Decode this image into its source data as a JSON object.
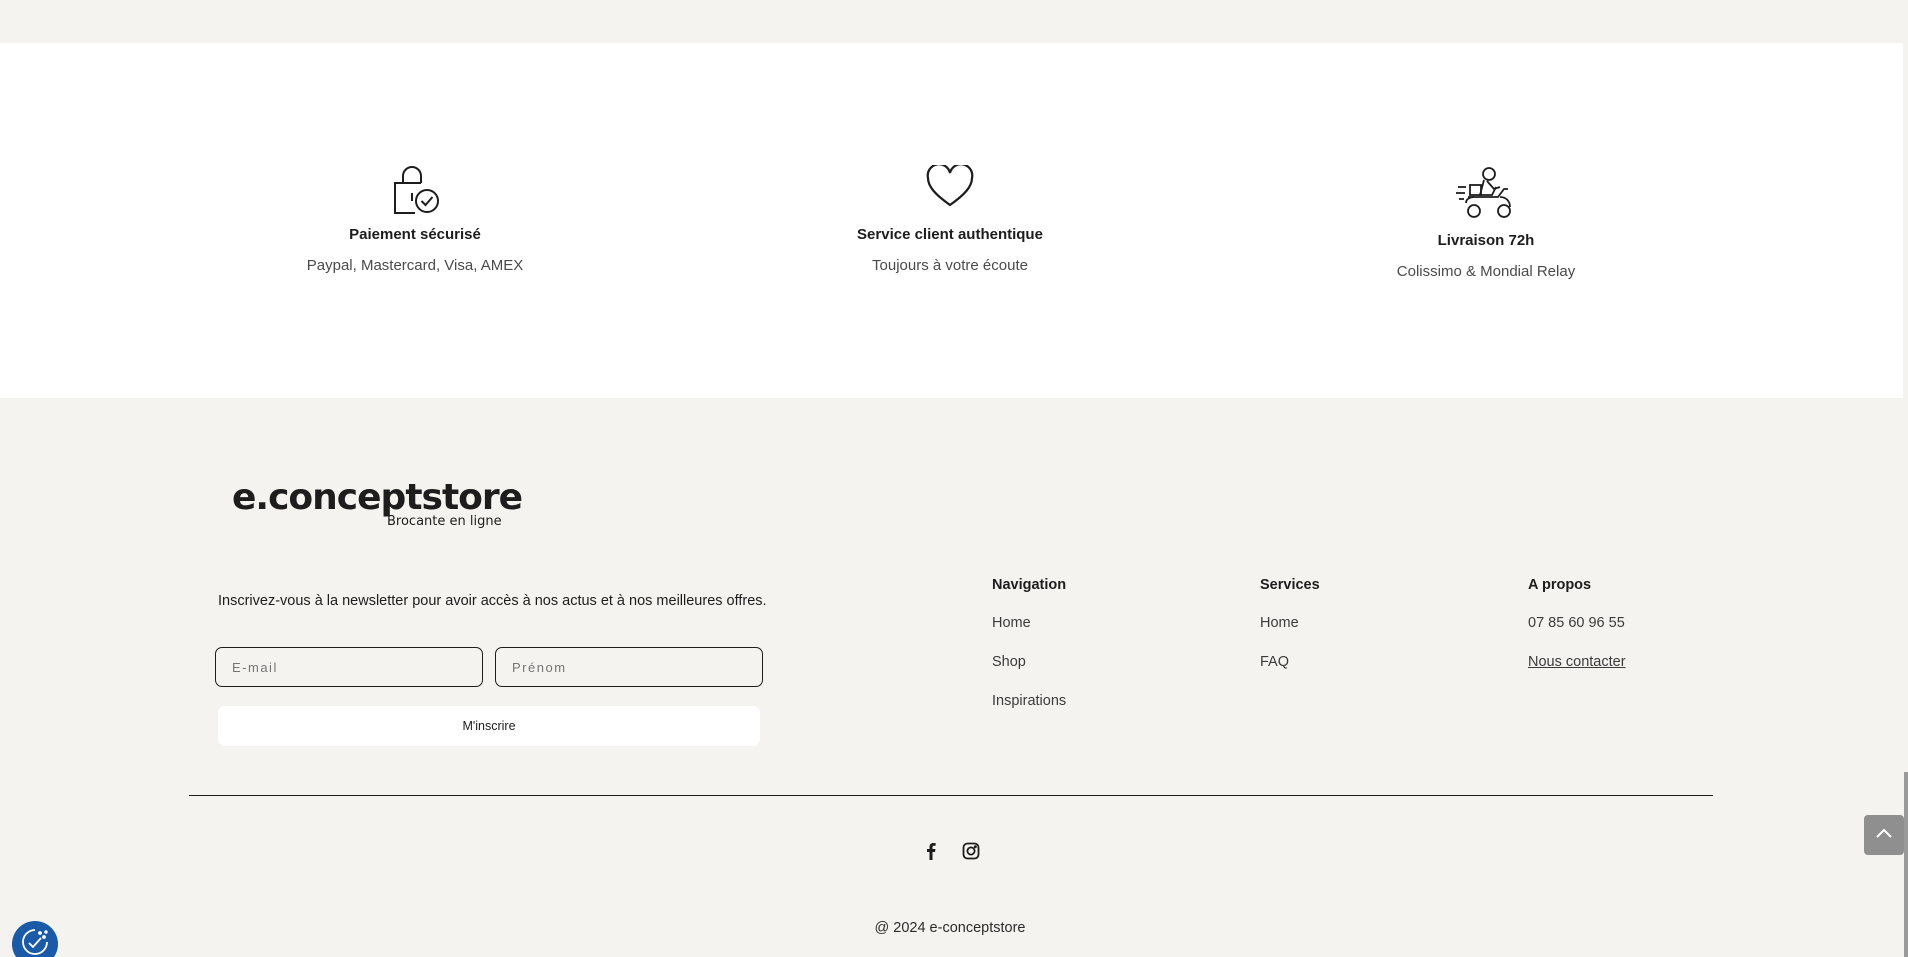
{
  "features": [
    {
      "icon": "lock-check-icon",
      "title": "Paiement sécurisé",
      "subtitle": "Paypal, Mastercard, Visa, AMEX"
    },
    {
      "icon": "heart-icon",
      "title": "Service client authentique",
      "subtitle": "Toujours à votre écoute"
    },
    {
      "icon": "delivery-scooter-icon",
      "title": "Livraison 72h",
      "subtitle": "Colissimo & Mondial Relay"
    }
  ],
  "logo": {
    "name": "e.conceptstore",
    "tagline": "Brocante en ligne"
  },
  "newsletter": {
    "text": "Inscrivez-vous à la newsletter pour avoir accès à nos actus et à nos meilleures offres.",
    "email_placeholder": "E-mail",
    "prenom_placeholder": "Prénom",
    "button_label": "M'inscrire"
  },
  "footer_columns": {
    "navigation": {
      "title": "Navigation",
      "links": [
        "Home",
        "Shop",
        "Inspirations"
      ]
    },
    "services": {
      "title": "Services",
      "links": [
        "Home",
        "FAQ"
      ]
    },
    "about": {
      "title": "A propos",
      "phone": "07 85 60 96 55",
      "contact_link": "Nous contacter"
    }
  },
  "social": [
    "facebook-icon",
    "instagram-icon"
  ],
  "copyright": "@ 2024 e-conceptstore",
  "colors": {
    "background": "#f4f3f0",
    "panel": "#ffffff",
    "text": "#1d1d1d",
    "cookie_button": "#1a5aa6",
    "back_to_top": "#8f8f8f"
  }
}
